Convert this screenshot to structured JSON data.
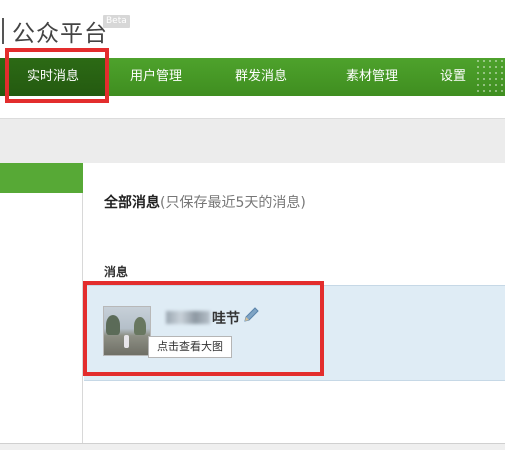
{
  "header": {
    "title": "公众平台",
    "badge": "Beta"
  },
  "nav": {
    "items": [
      {
        "label": "实时消息",
        "active": true
      },
      {
        "label": "用户管理",
        "active": false
      },
      {
        "label": "群发消息",
        "active": false
      },
      {
        "label": "素材管理",
        "active": false
      },
      {
        "label": "设置",
        "active": false
      }
    ]
  },
  "main": {
    "title": "全部消息",
    "note": "(只保存最近5天的消息)",
    "section_label": "消息",
    "message": {
      "name_suffix": "哇节",
      "edit_icon": "pencil-icon",
      "thumbnail_icon": "photo-thumbnail"
    },
    "tooltip": "点击查看大图"
  },
  "colors": {
    "nav_green": "#45982a",
    "nav_active": "#285f12",
    "sidebar_active": "#57a936",
    "message_row_bg": "#dfecf5",
    "annotation_red": "#e32d2d"
  }
}
